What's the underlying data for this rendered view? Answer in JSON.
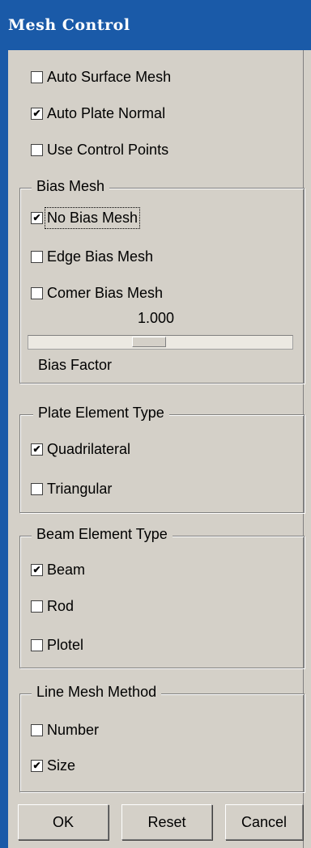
{
  "window": {
    "title": "Mesh Control"
  },
  "options": [
    {
      "label": "Auto Surface Mesh",
      "checked": false
    },
    {
      "label": "Auto Plate Normal",
      "checked": true
    },
    {
      "label": "Use Control Points",
      "checked": false
    }
  ],
  "bias_mesh": {
    "legend": "Bias Mesh",
    "items": [
      {
        "label": "No Bias Mesh",
        "checked": true
      },
      {
        "label": "Edge Bias Mesh",
        "checked": false
      },
      {
        "label": "Comer Bias Mesh",
        "checked": false
      }
    ],
    "slider_value": "1.000",
    "slider_label": "Bias Factor",
    "slider_fraction": 0.45
  },
  "plate_element_type": {
    "legend": "Plate Element Type",
    "items": [
      {
        "label": "Quadrilateral",
        "checked": true
      },
      {
        "label": "Triangular",
        "checked": false
      }
    ]
  },
  "beam_element_type": {
    "legend": "Beam Element Type",
    "items": [
      {
        "label": "Beam",
        "checked": true
      },
      {
        "label": "Rod",
        "checked": false
      },
      {
        "label": "Plotel",
        "checked": false
      }
    ]
  },
  "line_mesh_method": {
    "legend": "Line Mesh Method",
    "items": [
      {
        "label": "Number",
        "checked": false
      },
      {
        "label": "Size",
        "checked": true
      }
    ]
  },
  "buttons": {
    "ok": "OK",
    "reset": "Reset",
    "cancel": "Cancel"
  },
  "check_mark": "✔",
  "colors": {
    "title_bar": "#1a5aa8",
    "dialog_bg": "#d4d0c8",
    "title_text": "#ffffff"
  }
}
